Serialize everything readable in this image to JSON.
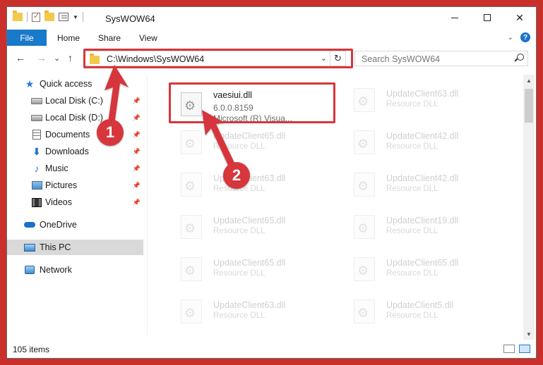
{
  "window": {
    "title": "SysWOW64"
  },
  "ribbon": {
    "file": "File",
    "home": "Home",
    "share": "Share",
    "view": "View",
    "help": "?"
  },
  "nav": {
    "back": "←",
    "forward": "→",
    "recent": "⌄",
    "up": "↑",
    "address": "C:\\Windows\\SysWOW64",
    "search_placeholder": "Search SysWOW64"
  },
  "sidebar": {
    "items": [
      {
        "label": "Quick access",
        "icon": "star-icon",
        "pinned": false
      },
      {
        "label": "Local Disk (C:)",
        "icon": "drive-icon",
        "pinned": true
      },
      {
        "label": "Local Disk (D:)",
        "icon": "drive-icon",
        "pinned": true
      },
      {
        "label": "Documents",
        "icon": "document-icon",
        "pinned": true
      },
      {
        "label": "Downloads",
        "icon": "download-icon",
        "pinned": true
      },
      {
        "label": "Music",
        "icon": "music-icon",
        "pinned": true
      },
      {
        "label": "Pictures",
        "icon": "picture-icon",
        "pinned": true
      },
      {
        "label": "Videos",
        "icon": "video-icon",
        "pinned": true
      },
      {
        "label": "OneDrive",
        "icon": "cloud-icon",
        "pinned": false
      },
      {
        "label": "This PC",
        "icon": "computer-icon",
        "pinned": false,
        "selected": true
      },
      {
        "label": "Network",
        "icon": "network-icon",
        "pinned": false
      }
    ]
  },
  "files": [
    {
      "name": "vaesiui.dll",
      "version": "6.0.0.8159",
      "description": "Microsoft (R) Visua...",
      "highlighted": true
    },
    {
      "name": "UpdateClient63.dll",
      "description": "Resource DLL"
    },
    {
      "name": "UpdateClient65.dll",
      "description": "Resource DLL"
    },
    {
      "name": "UpdateClient42.dll",
      "description": "Resource DLL"
    },
    {
      "name": "UpdateClient63.dll",
      "description": "Resource DLL"
    },
    {
      "name": "UpdateClient42.dll",
      "description": "Resource DLL"
    },
    {
      "name": "UpdateClient65.dll",
      "description": "Resource DLL"
    },
    {
      "name": "UpdateClient19.dll",
      "description": "Resource DLL"
    },
    {
      "name": "UpdateClient65.dll",
      "description": "Resource DLL"
    },
    {
      "name": "UpdateClient65.dll",
      "description": "Resource DLL"
    },
    {
      "name": "UpdateClient63.dll",
      "description": "Resource DLL"
    },
    {
      "name": "UpdateClient5.dll",
      "description": "Resource DLL"
    }
  ],
  "status": {
    "count": "105 items"
  },
  "annotations": {
    "step1": "1",
    "step2": "2",
    "color": "#d6363c"
  }
}
